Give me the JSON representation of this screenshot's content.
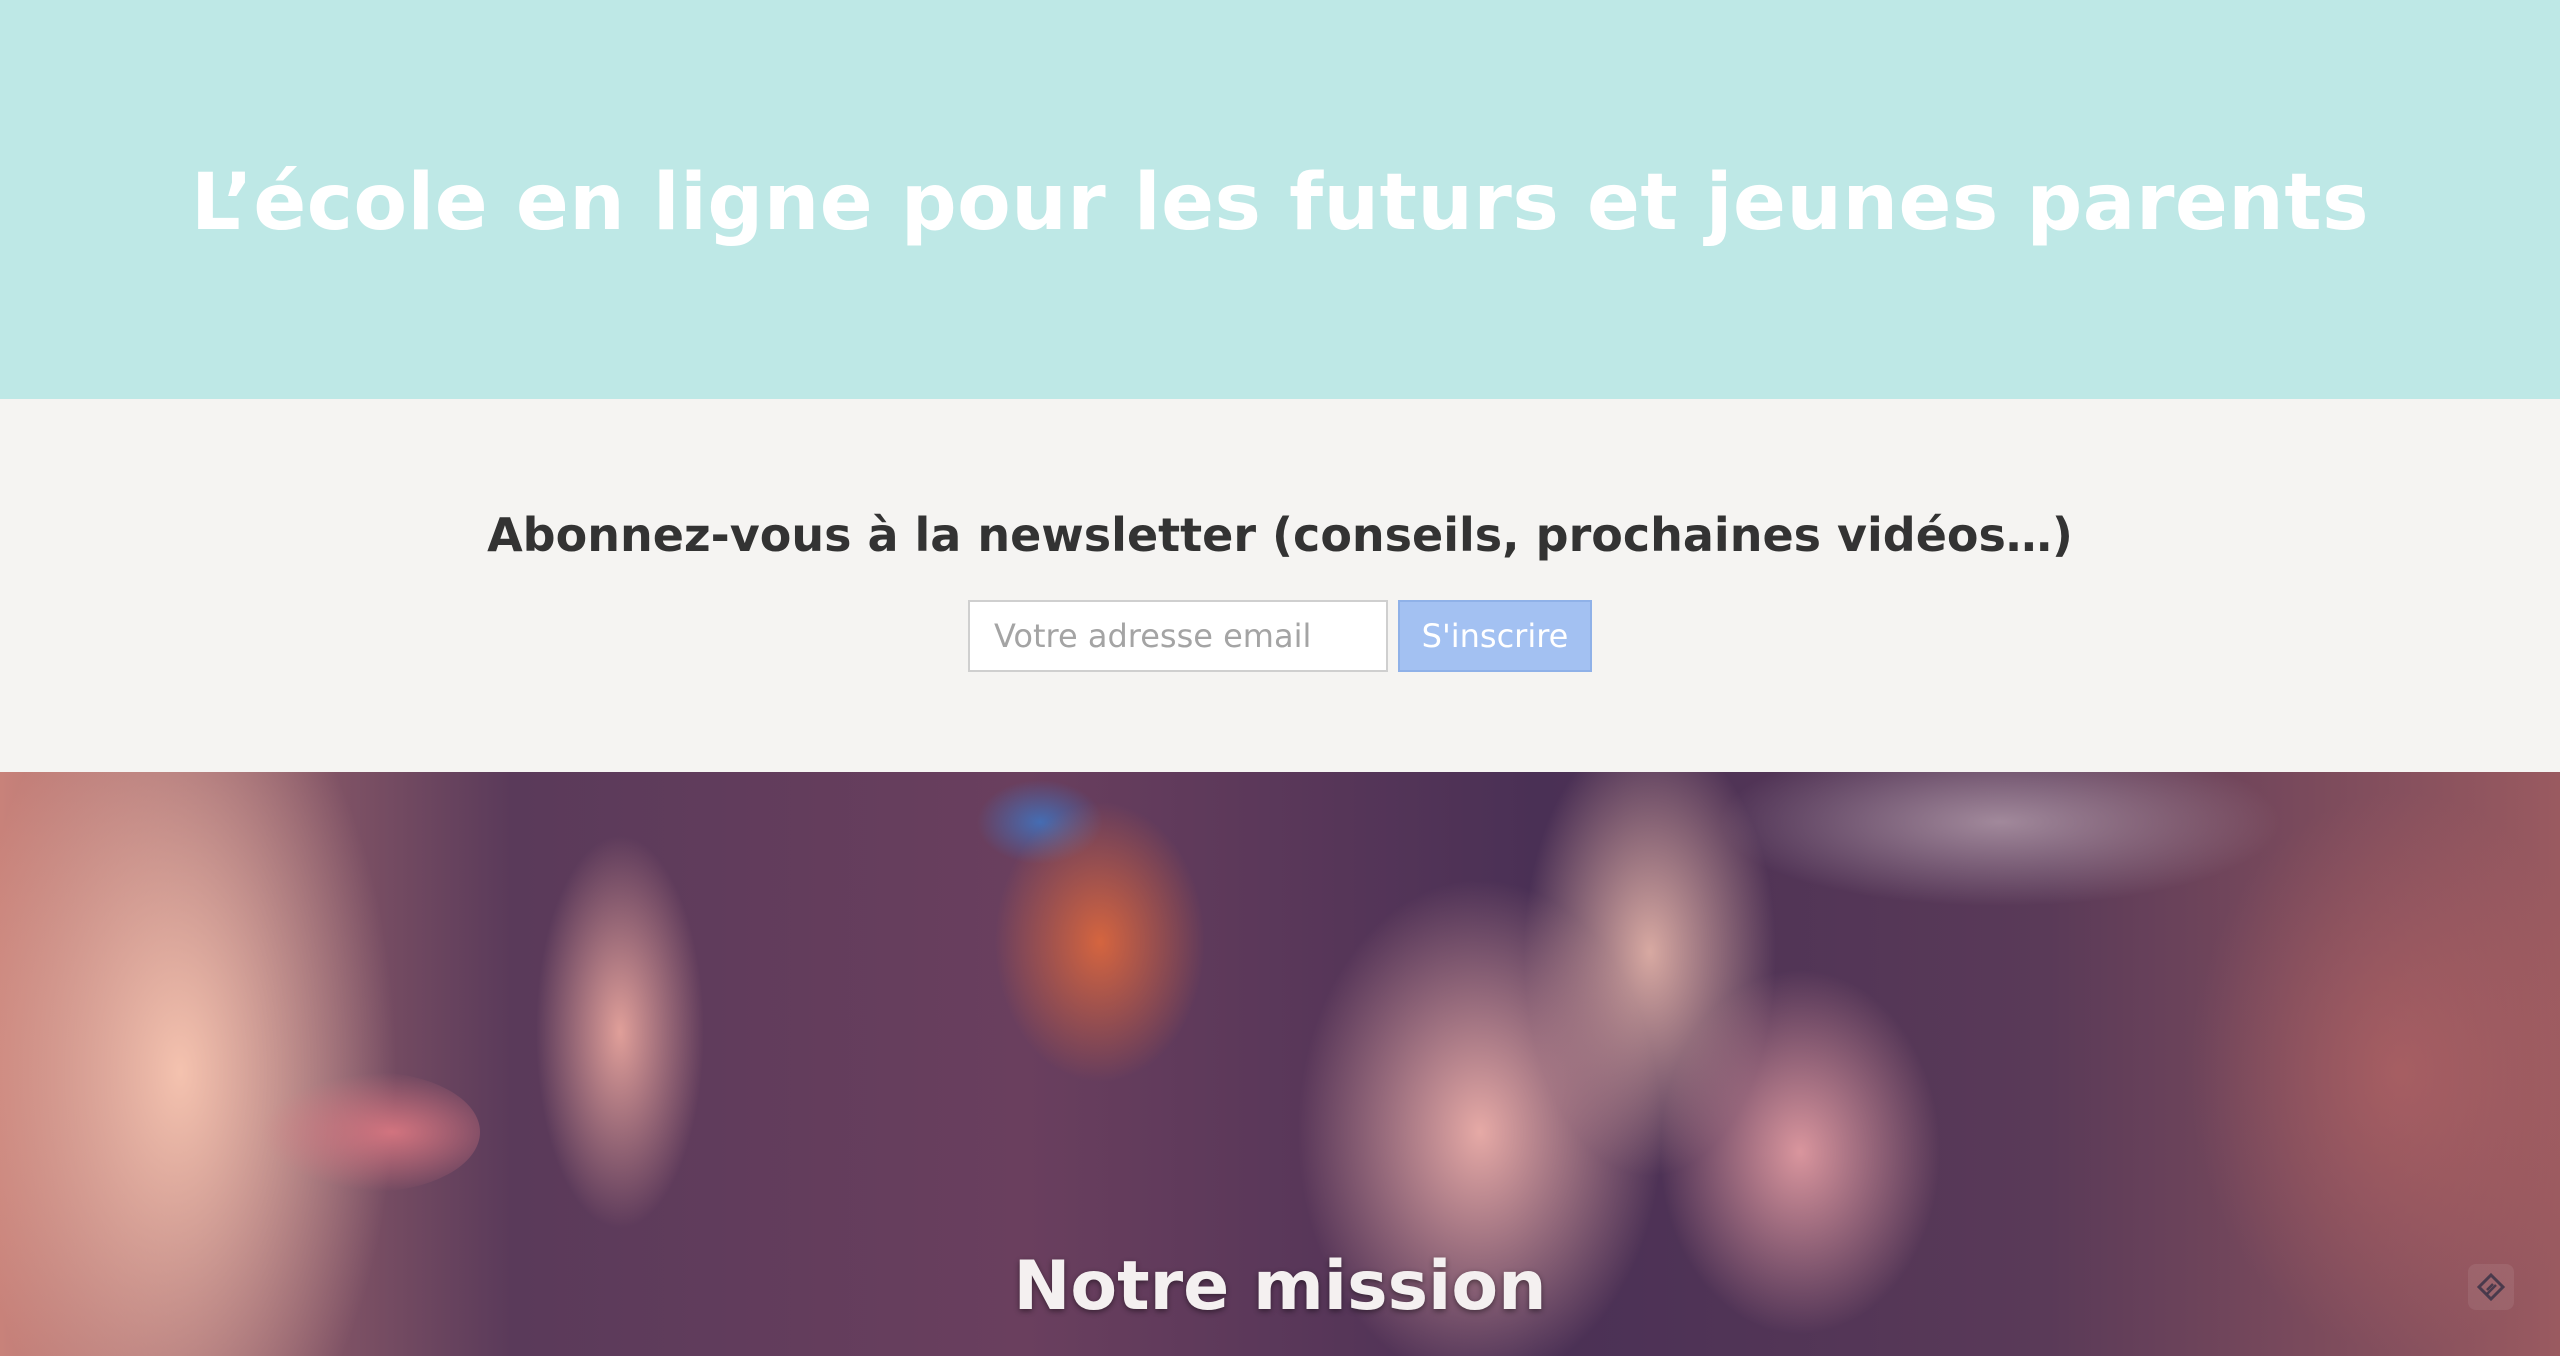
{
  "hero": {
    "title": "L’école en ligne pour les futurs et jeunes parents"
  },
  "newsletter": {
    "heading": "Abonnez-vous à la newsletter (conseils, prochaines vidéos…)",
    "email_placeholder": "Votre adresse email",
    "submit_label": "S'inscrire"
  },
  "mission": {
    "title": "Notre mission"
  },
  "icons": {
    "corner": "feedly-icon"
  },
  "colors": {
    "hero_bg": "#bee8e6",
    "newsletter_bg": "#f5f4f2",
    "button_bg": "#a3c1f2"
  }
}
